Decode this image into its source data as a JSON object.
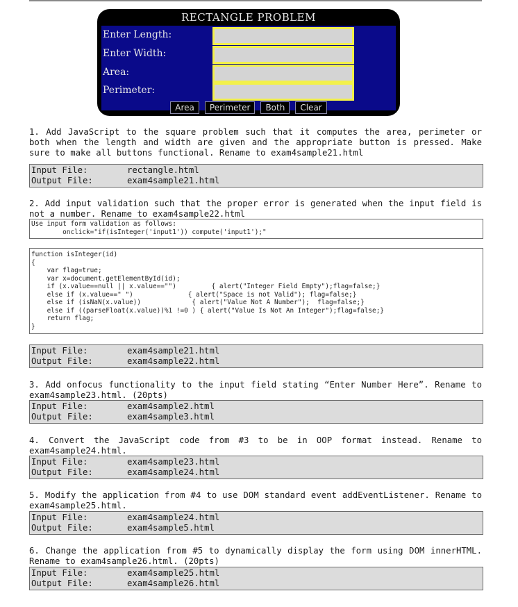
{
  "widget": {
    "title": "RECTANGLE PROBLEM",
    "fields": [
      {
        "label": "Enter Length:",
        "value": ""
      },
      {
        "label": "Enter Width:",
        "value": ""
      },
      {
        "label": "Area:",
        "value": ""
      },
      {
        "label": "Perimeter:",
        "value": ""
      }
    ],
    "buttons": [
      "Area",
      "Perimeter",
      "Both",
      "Clear"
    ],
    "colors": {
      "frame": "#000000",
      "panel": "#0a0a8a",
      "field_border": "#f2f04a",
      "field_fill": "#d4d4d4"
    }
  },
  "labels": {
    "input_file": "Input File:",
    "output_file": "Output File:"
  },
  "tasks": [
    {
      "text": "1. Add JavaScript to the square problem such that it computes the area, perimeter or both when the length and width are given and the appropriate button is pressed. Make sure to make all buttons functional. Rename to exam4sample21.html",
      "input_file": "rectangle.html",
      "output_file": "exam4sample21.html"
    },
    {
      "text": "2. Add input validation such that the proper error is generated when the input field is not a number. Rename to exam4sample22.html",
      "hint_lines": [
        "Use input form validation as follows:",
        "        onclick=\"if(isInteger('input1')) compute('input1');\""
      ],
      "code_lines": [
        "function isInteger(id)",
        "{",
        "    var flag=true;",
        "    var x=document.getElementById(id);",
        "    if (x.value==null || x.value==\"\")         { alert(\"Integer Field Empty\");flag=false;}",
        "    else if (x.value==\" \")              { alert(\"Space is not Valid\"); flag=false;}",
        "    else if (isNaN(x.value))             { alert(\"Value Not A Number\");  flag=false;}",
        "    else if ((parseFloat(x.value))%1 !=0 ) { alert(\"Value Is Not An Integer\");flag=false;}",
        "    return flag;",
        "}"
      ],
      "input_file": "exam4sample21.html",
      "output_file": "exam4sample22.html"
    },
    {
      "text": "3. Add onfocus functionality to the input field stating “Enter Number Here”. Rename to exam4sample23.html. (20pts)",
      "input_file": "exam4sample2.html",
      "output_file": "exam4sample3.html"
    },
    {
      "text": "4. Convert the JavaScript code from #3 to be in OOP format instead. Rename to exam4sample24.html.",
      "input_file": "exam4sample23.html",
      "output_file": "exam4sample24.html"
    },
    {
      "text": "5. Modify the application from #4 to use DOM standard event addEventListener. Rename to exam4sample25.html.",
      "input_file": "exam4sample24.html",
      "output_file": "exam4sample5.html"
    },
    {
      "text": "6. Change the application from #5 to dynamically display the form using DOM innerHTML. Rename to exam4sample26.html. (20pts)",
      "input_file": "exam4sample25.html",
      "output_file": "exam4sample26.html"
    }
  ]
}
